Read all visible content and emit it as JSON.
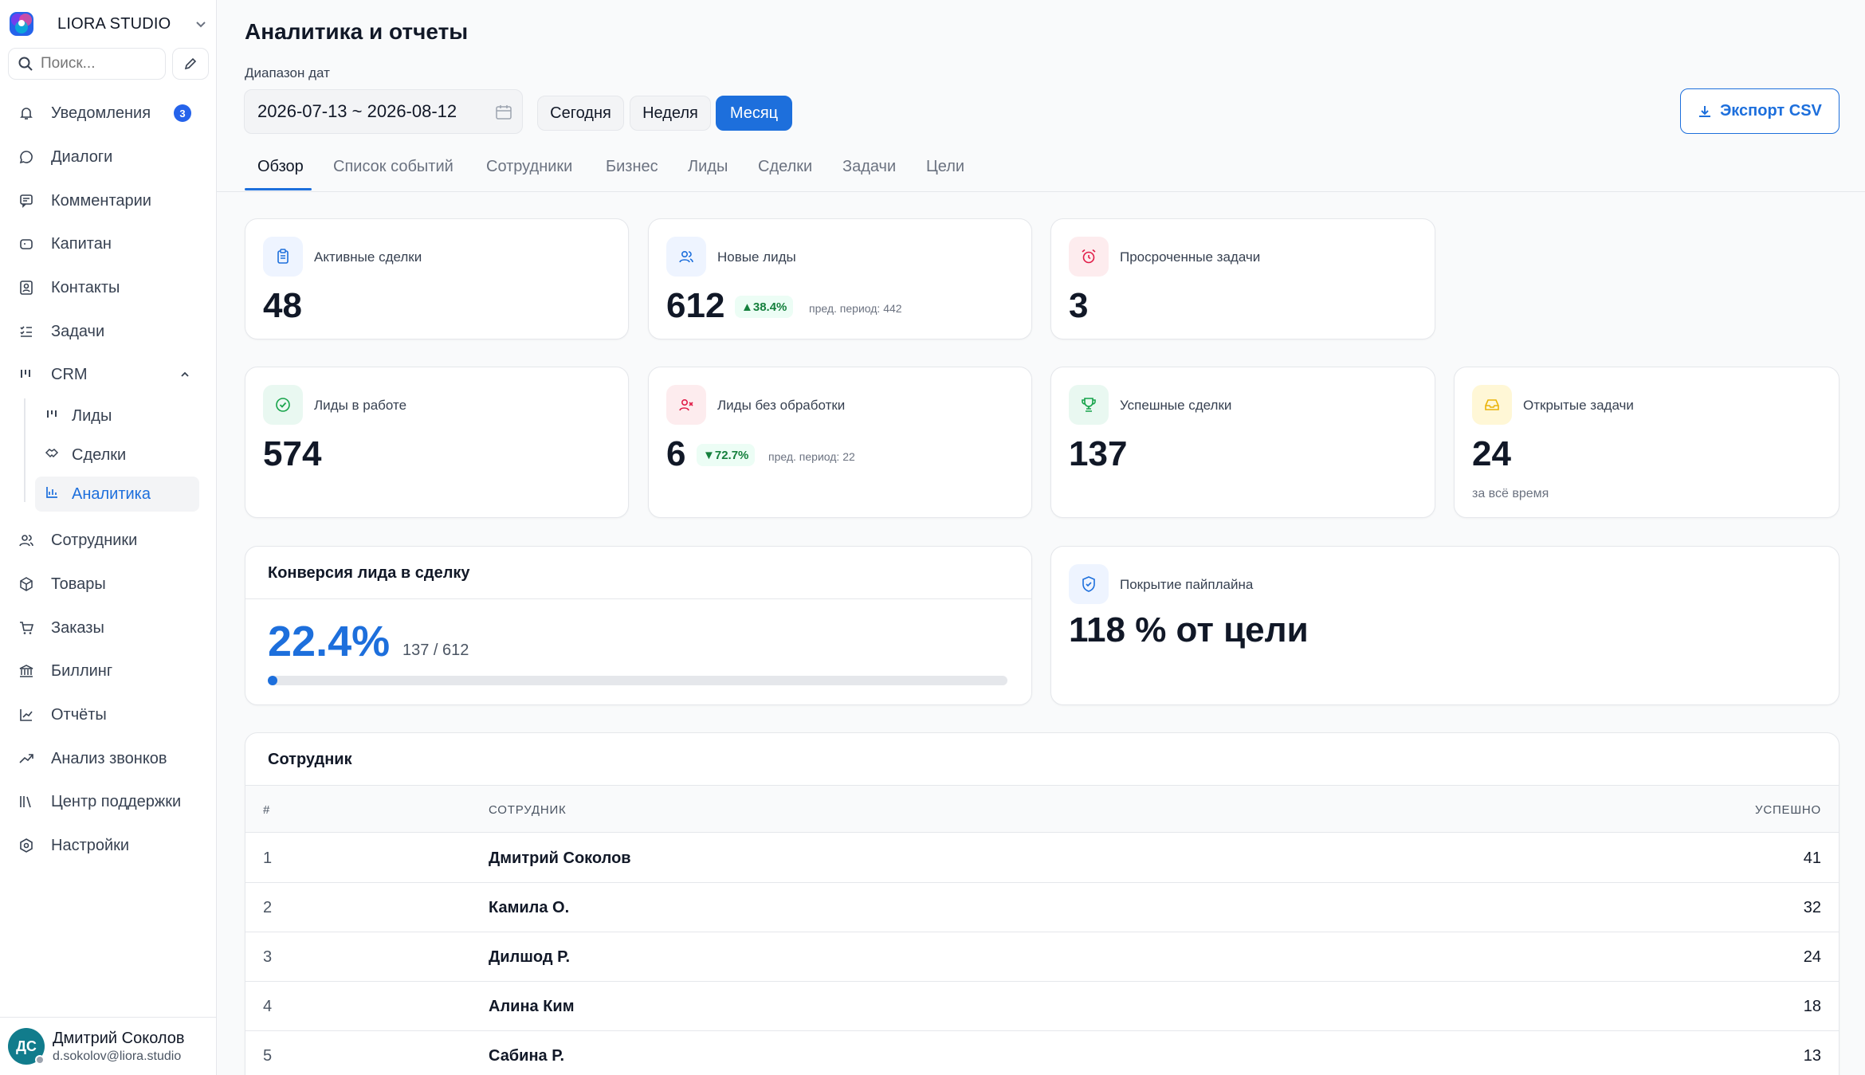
{
  "brand": {
    "name": "LIORA STUDIO"
  },
  "search": {
    "placeholder": "Поиск..."
  },
  "nav": {
    "notifications": {
      "label": "Уведомления",
      "badge": "3"
    },
    "dialogs": "Диалоги",
    "comments": "Комментарии",
    "captain": "Капитан",
    "contacts": "Контакты",
    "tasks": "Задачи",
    "crm": "CRM",
    "crm_sub": {
      "leads": "Лиды",
      "deals": "Сделки",
      "analytics": "Аналитика"
    },
    "employees": "Сотрудники",
    "products": "Товары",
    "orders": "Заказы",
    "billing": "Биллинг",
    "reports": "Отчёты",
    "call_analysis": "Анализ звонков",
    "support": "Центр поддержки",
    "settings": "Настройки"
  },
  "user": {
    "initials": "ДС",
    "name": "Дмитрий Соколов",
    "email": "d.sokolov@liora.studio"
  },
  "header": {
    "title": "Аналитика и отчеты",
    "date_label": "Диапазон дат",
    "date_range": "2026-07-13 ~ 2026-08-12",
    "range_today": "Сегодня",
    "range_week": "Неделя",
    "range_month": "Месяц",
    "export": "Экспорт CSV"
  },
  "tabs": [
    "Обзор",
    "Список событий",
    "Сотрудники",
    "Бизнес",
    "Лиды",
    "Сделки",
    "Задачи",
    "Цели"
  ],
  "stats": {
    "active_deals": {
      "title": "Активные сделки",
      "value": "48"
    },
    "new_leads": {
      "title": "Новые лиды",
      "value": "612",
      "delta": "▲38.4%",
      "prev": "пред. период: 442"
    },
    "overdue_tasks": {
      "title": "Просроченные задачи",
      "value": "3"
    },
    "leads_in_work": {
      "title": "Лиды в работе",
      "value": "574"
    },
    "unprocessed_leads": {
      "title": "Лиды без обработки",
      "value": "6",
      "delta": "▼72.7%",
      "prev": "пред. период: 22"
    },
    "won_deals": {
      "title": "Успешные сделки",
      "value": "137"
    },
    "open_tasks": {
      "title": "Открытые задачи",
      "value": "24",
      "sub": "за всё время"
    }
  },
  "conversion": {
    "title": "Конверсия лида в сделку",
    "percent": "22.4%",
    "ratio": "137 / 612",
    "progress": 0.01
  },
  "coverage": {
    "title": "Покрытие пайплайна",
    "value": "118 % от цели"
  },
  "table": {
    "title": "Сотрудник",
    "columns": [
      "#",
      "СОТРУДНИК",
      "УСПЕШНО"
    ],
    "rows": [
      {
        "n": "1",
        "name": "Дмитрий Соколов",
        "won": "41"
      },
      {
        "n": "2",
        "name": "Камила О.",
        "won": "32"
      },
      {
        "n": "3",
        "name": "Дилшод Р.",
        "won": "24"
      },
      {
        "n": "4",
        "name": "Алина Ким",
        "won": "18"
      },
      {
        "n": "5",
        "name": "Сабина Р.",
        "won": "13"
      }
    ]
  },
  "colors": {
    "accent": "#1d6fdc",
    "avatar": "#117c8c",
    "positive": "#15803d"
  }
}
